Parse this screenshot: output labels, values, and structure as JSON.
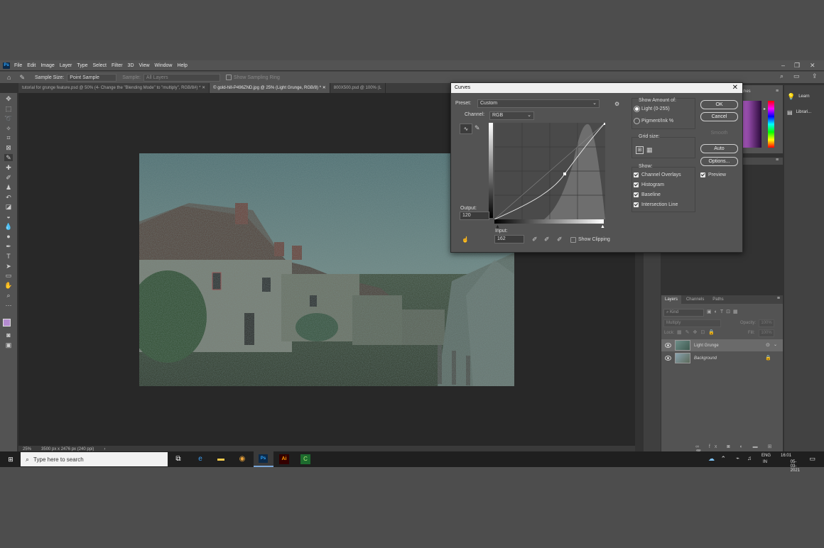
{
  "menu": {
    "app_icon": "Ps",
    "items": [
      "File",
      "Edit",
      "Image",
      "Layer",
      "Type",
      "Select",
      "Filter",
      "3D",
      "View",
      "Window",
      "Help"
    ]
  },
  "options_bar": {
    "sample_size_label": "Sample Size:",
    "sample_size_value": "Point Sample",
    "sample_label": "Sample:",
    "sample_value": "All Layers",
    "show_ring_label": "Show Sampling Ring"
  },
  "tabs": [
    "tutorial for grunge feature.psd @ 50% (4- Change the \"Blending Mode\" to \"multiply\", RGB/8#) *",
    "© gold-hill-P496ZND.jpg @ 25% (Light Grunge, RGB/8) *",
    "800X500.psd @ 100% (L"
  ],
  "status": {
    "zoom": "25%",
    "doc_size": "3500 px x 2476 px (240 ppi)"
  },
  "right_panel": {
    "learn": "Learn",
    "libraries": "Librari...",
    "color_tab_partial": "ches"
  },
  "layers_panel": {
    "tabs": [
      "Layers",
      "Channels",
      "Paths"
    ],
    "filter_kind": "Kind",
    "blend_mode": "Multiply",
    "opacity_label": "Opacity:",
    "opacity_value": "100%",
    "lock_label": "Lock:",
    "fill_label": "Fill:",
    "fill_value": "100%",
    "layers": [
      {
        "name": "Light Grunge"
      },
      {
        "name": "Background"
      }
    ]
  },
  "curves": {
    "title": "Curves",
    "preset_label": "Preset:",
    "preset_value": "Custom",
    "channel_label": "Channel:",
    "channel_value": "RGB",
    "output_label": "Output:",
    "output_value": "120",
    "input_label": "Input:",
    "input_value": "162",
    "show_clipping": "Show Clipping",
    "show_amount_label": "Show Amount of:",
    "light_option": "Light  (0-255)",
    "pigment_option": "Pigment/Ink %",
    "grid_size_label": "Grid size:",
    "show_label": "Show:",
    "show_options": [
      "Channel Overlays",
      "Histogram",
      "Baseline",
      "Intersection Line"
    ],
    "buttons": {
      "ok": "OK",
      "cancel": "Cancel",
      "smooth": "Smooth",
      "auto": "Auto",
      "options": "Options..."
    },
    "preview_label": "Preview"
  },
  "taskbar": {
    "search_placeholder": "Type here to search",
    "lang_top": "ENG",
    "lang_bottom": "IN",
    "time": "16:01",
    "date": "05-03-2021"
  }
}
